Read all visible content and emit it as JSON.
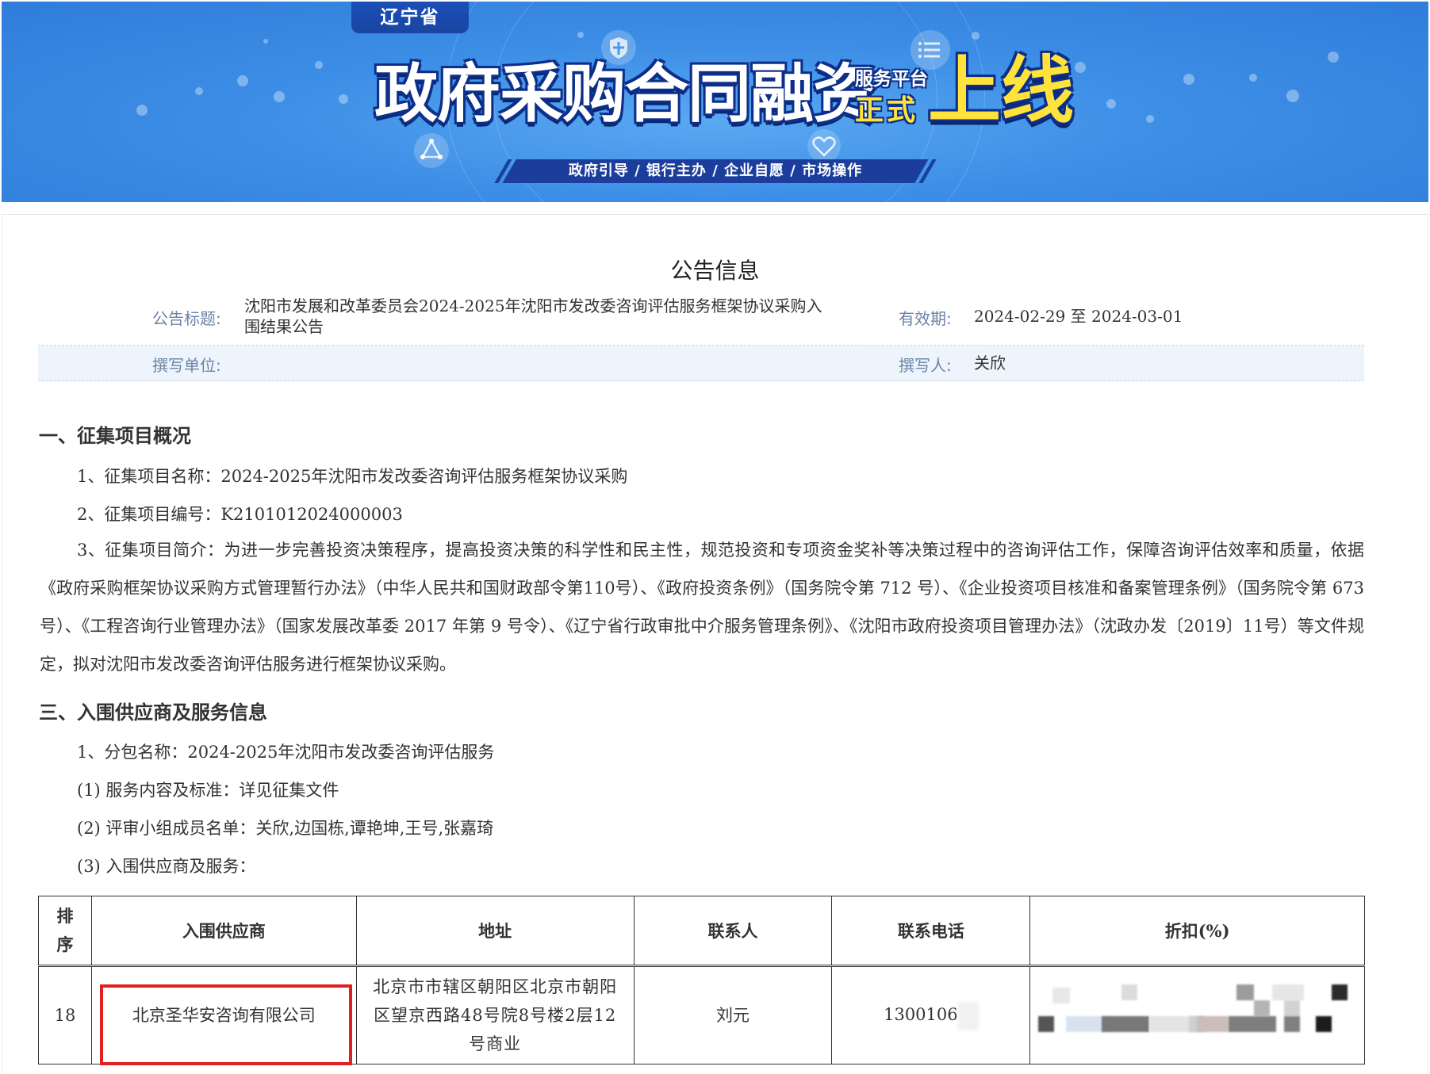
{
  "banner": {
    "province": "辽宁省",
    "title": "政府采购合同融资",
    "service_platform": "服务平台",
    "official": "正式",
    "online": "上线",
    "slogan": "政府引导 / 银行主办 / 企业自愿 / 市场操作"
  },
  "notice": {
    "page_title": "公告信息",
    "title_label": "公告标题:",
    "title_value": "沈阳市发展和改革委员会2024-2025年沈阳市发改委咨询评估服务框架协议采购入围结果公告",
    "validity_label": "有效期:",
    "validity_value": "2024-02-29 至 2024-03-01",
    "org_label": "撰写单位:",
    "org_value": "",
    "author_label": "撰写人:",
    "author_value": "关欣"
  },
  "section1": {
    "heading": "一、征集项目概况",
    "item1": "1、征集项目名称：2024-2025年沈阳市发改委咨询评估服务框架协议采购",
    "item2": "2、征集项目编号：K2101012024000003",
    "item3": "3、征集项目简介：为进一步完善投资决策程序，提高投资决策的科学性和民主性，规范投资和专项资金奖补等决策过程中的咨询评估工作，保障咨询评估效率和质量，依据《政府采购框架协议采购方式管理暂行办法》（中华人民共和国财政部令第110号）、《政府投资条例》（国务院令第 712 号）、《企业投资项目核准和备案管理条例》（国务院令第 673 号）、《工程咨询行业管理办法》（国家发展改革委 2017 年第 9 号令）、《辽宁省行政审批中介服务管理条例》、《沈阳市政府投资项目管理办法》（沈政办发〔2019〕11号）等文件规定，拟对沈阳市发改委咨询评估服务进行框架协议采购。"
  },
  "section3": {
    "heading": "三、入围供应商及服务信息",
    "item1": "1、分包名称：2024-2025年沈阳市发改委咨询评估服务",
    "item2": "(1) 服务内容及标准：详见征集文件",
    "item3": "(2) 评审小组成员名单：关欣,边国栋,谭艳坤,王号,张嘉琦",
    "item4": "(3) 入围供应商及服务："
  },
  "table": {
    "headers": [
      "排序",
      "入围供应商",
      "地址",
      "联系人",
      "联系电话",
      "折扣(%)"
    ],
    "rows": [
      {
        "rank": "18",
        "supplier": "北京圣华安咨询有限公司",
        "address": "北京市市辖区朝阳区北京市朝阳区望京西路48号院8号楼2层12号商业",
        "contact": "刘元",
        "phone": "1300106",
        "discount": ""
      }
    ]
  },
  "colors": {
    "banner_blue": "#3d8ee6",
    "label_blue": "#6a83a6",
    "highlight_red": "#e02020",
    "accent_yellow": "#ffe23a"
  }
}
